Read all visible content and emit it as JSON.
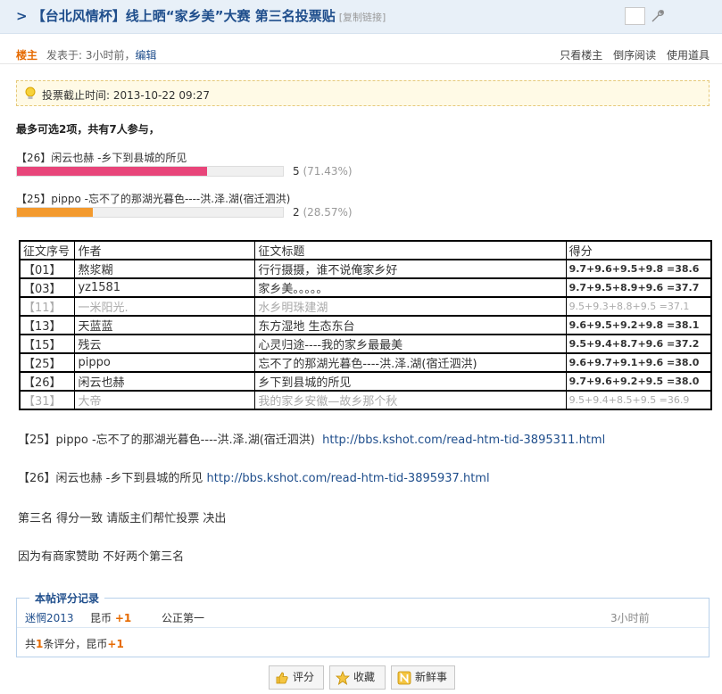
{
  "header": {
    "title": "> 【台北风情杯】线上晒“家乡美”大赛  第三名投票贴",
    "copy_link": "[复制链接]"
  },
  "author_bar": {
    "role": "楼主",
    "posted": "发表于: 3小时前，",
    "edit": "编辑",
    "tools": [
      "只看楼主",
      "倒序阅读",
      "使用道具"
    ]
  },
  "deadline": {
    "text": "投票截止时间: 2013-10-22 09:27"
  },
  "poll": {
    "heading": "最多可选2项，共有7人参与，",
    "options": [
      {
        "label": "【26】闲云也赫 -乡下到县城的所见",
        "count": "5",
        "percent": "(71.43%)",
        "fraction": 0.7143,
        "color": "#e8457a"
      },
      {
        "label": "【25】pippo -忘不了的那湖光暮色----洪.泽.湖(宿迁泗洪)",
        "count": "2",
        "percent": "(28.57%)",
        "fraction": 0.2857,
        "color": "#f39a2e"
      }
    ]
  },
  "table": {
    "headers": [
      "征文序号",
      "作者",
      "征文标题",
      "得分"
    ],
    "rows": [
      {
        "id": "【01】",
        "author": "熬浆糊",
        "title": "行行摄摄，谁不说俺家乡好",
        "score": "9.7+9.6+9.5+9.8 =38.6",
        "grey": false
      },
      {
        "id": "【03】",
        "author": "yz1581",
        "title": "家乡美。。。。。",
        "score": "9.7+9.5+8.9+9.6 =37.7",
        "grey": false
      },
      {
        "id": "【11】",
        "author": "一米阳光.",
        "title": "水乡明珠建湖",
        "score": "9.5+9.3+8.8+9.5 =37.1",
        "grey": true
      },
      {
        "id": "【13】",
        "author": "天蓝蓝",
        "title": "东方湿地 生态东台",
        "score": "9.6+9.5+9.2+9.8 =38.1",
        "grey": false
      },
      {
        "id": "【15】",
        "author": "残云",
        "title": "心灵归途----我的家乡最最美",
        "score": "9.5+9.4+8.7+9.6 =37.2",
        "grey": false
      },
      {
        "id": "【25】",
        "author": "pippo",
        "title": "忘不了的那湖光暮色----洪.泽.湖(宿迁泗洪)",
        "score": "9.6+9.7+9.1+9.6 =38.0",
        "grey": false
      },
      {
        "id": "【26】",
        "author": "闲云也赫",
        "title": "乡下到县城的所见",
        "score": "9.7+9.6+9.2+9.5 =38.0",
        "grey": false
      },
      {
        "id": "【31】",
        "author": "大帝",
        "title": "我的家乡安徽—故乡那个秋",
        "score": "9.5+9.4+8.5+9.5 =36.9",
        "grey": true
      }
    ]
  },
  "body": {
    "line1_text": "【25】pippo -忘不了的那湖光暮色----洪.泽.湖(宿迁泗洪)",
    "line1_link": "http://bbs.kshot.com/read-htm-tid-3895311.html",
    "line2_text": "【26】闲云也赫 -乡下到县城的所见",
    "line2_link": "http://bbs.kshot.com/read-htm-tid-3895937.html",
    "line3": "第三名 得分一致  请版主们帮忙投票 决出",
    "line4": "因为有商家赞助 不好两个第三名"
  },
  "rating": {
    "legend": "本帖评分记录",
    "user": "迷惘2013",
    "coin_label": "昆币",
    "coin_value": "+1",
    "reason": "公正第一",
    "time": "3小时前",
    "summary_prefix": "共",
    "summary_count": "1",
    "summary_mid": "条评分，昆币",
    "summary_value": "+1"
  },
  "buttons": {
    "rate": "评分",
    "favorite": "收藏",
    "news": "新鲜事"
  }
}
